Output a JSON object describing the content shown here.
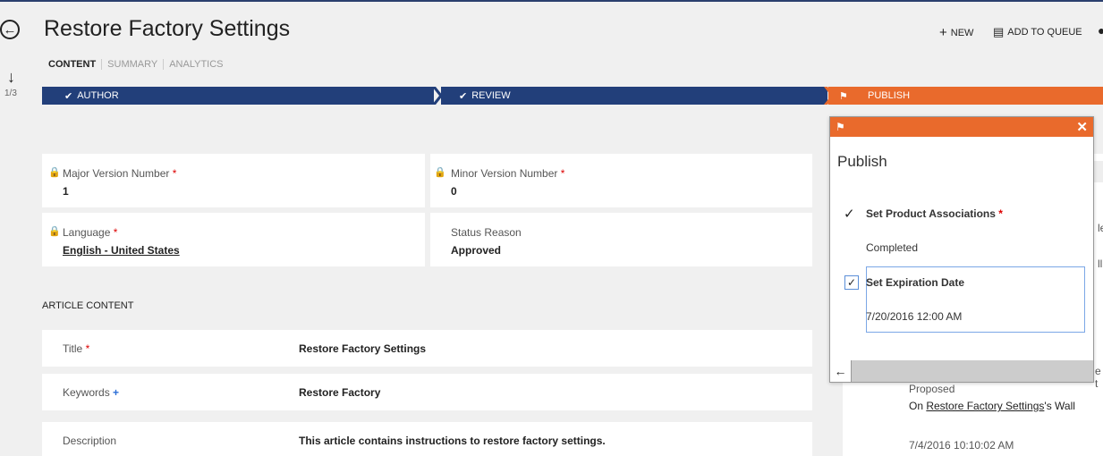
{
  "header": {
    "title": "Restore Factory Settings",
    "tabs": [
      "CONTENT",
      "SUMMARY",
      "ANALYTICS"
    ],
    "record_counter": "1/3"
  },
  "commands": {
    "new_label": "NEW",
    "add_to_queue_label": "ADD TO QUEUE"
  },
  "stages": [
    {
      "label": "AUTHOR"
    },
    {
      "label": "REVIEW"
    },
    {
      "label": "PUBLISH"
    }
  ],
  "fields": {
    "major_version": {
      "label": "Major Version Number",
      "value": "1",
      "required": "*"
    },
    "minor_version": {
      "label": "Minor Version Number",
      "value": "0",
      "required": "*"
    },
    "language": {
      "label": "Language",
      "value": "English - United States",
      "required": "*"
    },
    "status_reason": {
      "label": "Status Reason",
      "value": "Approved"
    }
  },
  "article": {
    "section_title": "ARTICLE CONTENT",
    "rows": [
      {
        "label": "Title",
        "marker": "*",
        "value": "Restore Factory Settings"
      },
      {
        "label": "Keywords",
        "marker": "+",
        "value": "Restore Factory"
      },
      {
        "label": "Description",
        "marker": "",
        "value": "This article contains instructions to restore factory settings."
      }
    ]
  },
  "flyout": {
    "title": "Publish",
    "steps": [
      {
        "label": "Set Product Associations",
        "required": "*",
        "value": "Completed"
      },
      {
        "label": "Set Expiration Date",
        "value": "7/20/2016 12:00 AM"
      }
    ]
  },
  "activity": {
    "status": "Proposed",
    "on_prefix": "On ",
    "wall_link": "Restore Factory Settings",
    "wall_suffix": "'s Wall",
    "timestamp": "7/4/2016 10:10:02 AM",
    "clipped_1": "le",
    "clipped_2": "ll",
    "clipped_3": "e t"
  },
  "colors": {
    "stage_done": "#223f7a",
    "stage_active": "#e96a2c"
  }
}
